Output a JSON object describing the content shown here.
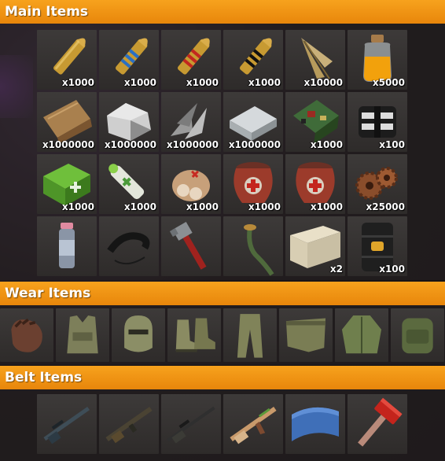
{
  "sections": {
    "main": {
      "title": "Main Items"
    },
    "wear": {
      "title": "Wear Items"
    },
    "belt": {
      "title": "Belt Items"
    }
  },
  "main_items": [
    {
      "icon": "rifle-ammo-icon",
      "qty": "x1000"
    },
    {
      "icon": "hv-rifle-ammo-icon",
      "qty": "x1000"
    },
    {
      "icon": "incendiary-rifle-ammo-icon",
      "qty": "x1000"
    },
    {
      "icon": "explosive-rifle-ammo-icon",
      "qty": "x1000"
    },
    {
      "icon": "arrow-icon",
      "qty": "x10000"
    },
    {
      "icon": "low-grade-fuel-icon",
      "qty": "x5000"
    },
    {
      "icon": "wood-icon",
      "qty": "x1000000"
    },
    {
      "icon": "stones-icon",
      "qty": "x1000000"
    },
    {
      "icon": "metal-fragments-icon",
      "qty": "x1000000"
    },
    {
      "icon": "hq-metal-icon",
      "qty": "x1000000"
    },
    {
      "icon": "tech-trash-icon",
      "qty": "x1000"
    },
    {
      "icon": "sewing-kit-icon",
      "qty": "x100"
    },
    {
      "icon": "medical-kit-icon",
      "qty": "x1000"
    },
    {
      "icon": "syringe-icon",
      "qty": "x1000"
    },
    {
      "icon": "bandage-icon",
      "qty": "x1000"
    },
    {
      "icon": "explosives-pot-icon",
      "qty": "x1000"
    },
    {
      "icon": "explosives-pot-icon",
      "qty": "x1000"
    },
    {
      "icon": "gears-icon",
      "qty": "x25000"
    },
    {
      "icon": "spray-can-icon",
      "qty": ""
    },
    {
      "icon": "rope-icon",
      "qty": ""
    },
    {
      "icon": "pipe-wrench-icon",
      "qty": ""
    },
    {
      "icon": "hose-icon",
      "qty": ""
    },
    {
      "icon": "wooden-box-icon",
      "qty": "x2"
    },
    {
      "icon": "oil-barrel-icon",
      "qty": "x100"
    }
  ],
  "wear_items": [
    {
      "icon": "gloves-icon"
    },
    {
      "icon": "vest-icon"
    },
    {
      "icon": "facemask-icon"
    },
    {
      "icon": "boots-icon"
    },
    {
      "icon": "pants-icon"
    },
    {
      "icon": "kilt-icon"
    },
    {
      "icon": "jacket-icon"
    },
    {
      "icon": "backpack-icon"
    }
  ],
  "belt_items": [
    {
      "icon": "sniper-rifle-icon"
    },
    {
      "icon": "assault-rifle-icon"
    },
    {
      "icon": "bolt-rifle-icon"
    },
    {
      "icon": "ak-rifle-icon"
    },
    {
      "icon": "blueprint-paper-icon"
    },
    {
      "icon": "sledgehammer-icon"
    }
  ]
}
